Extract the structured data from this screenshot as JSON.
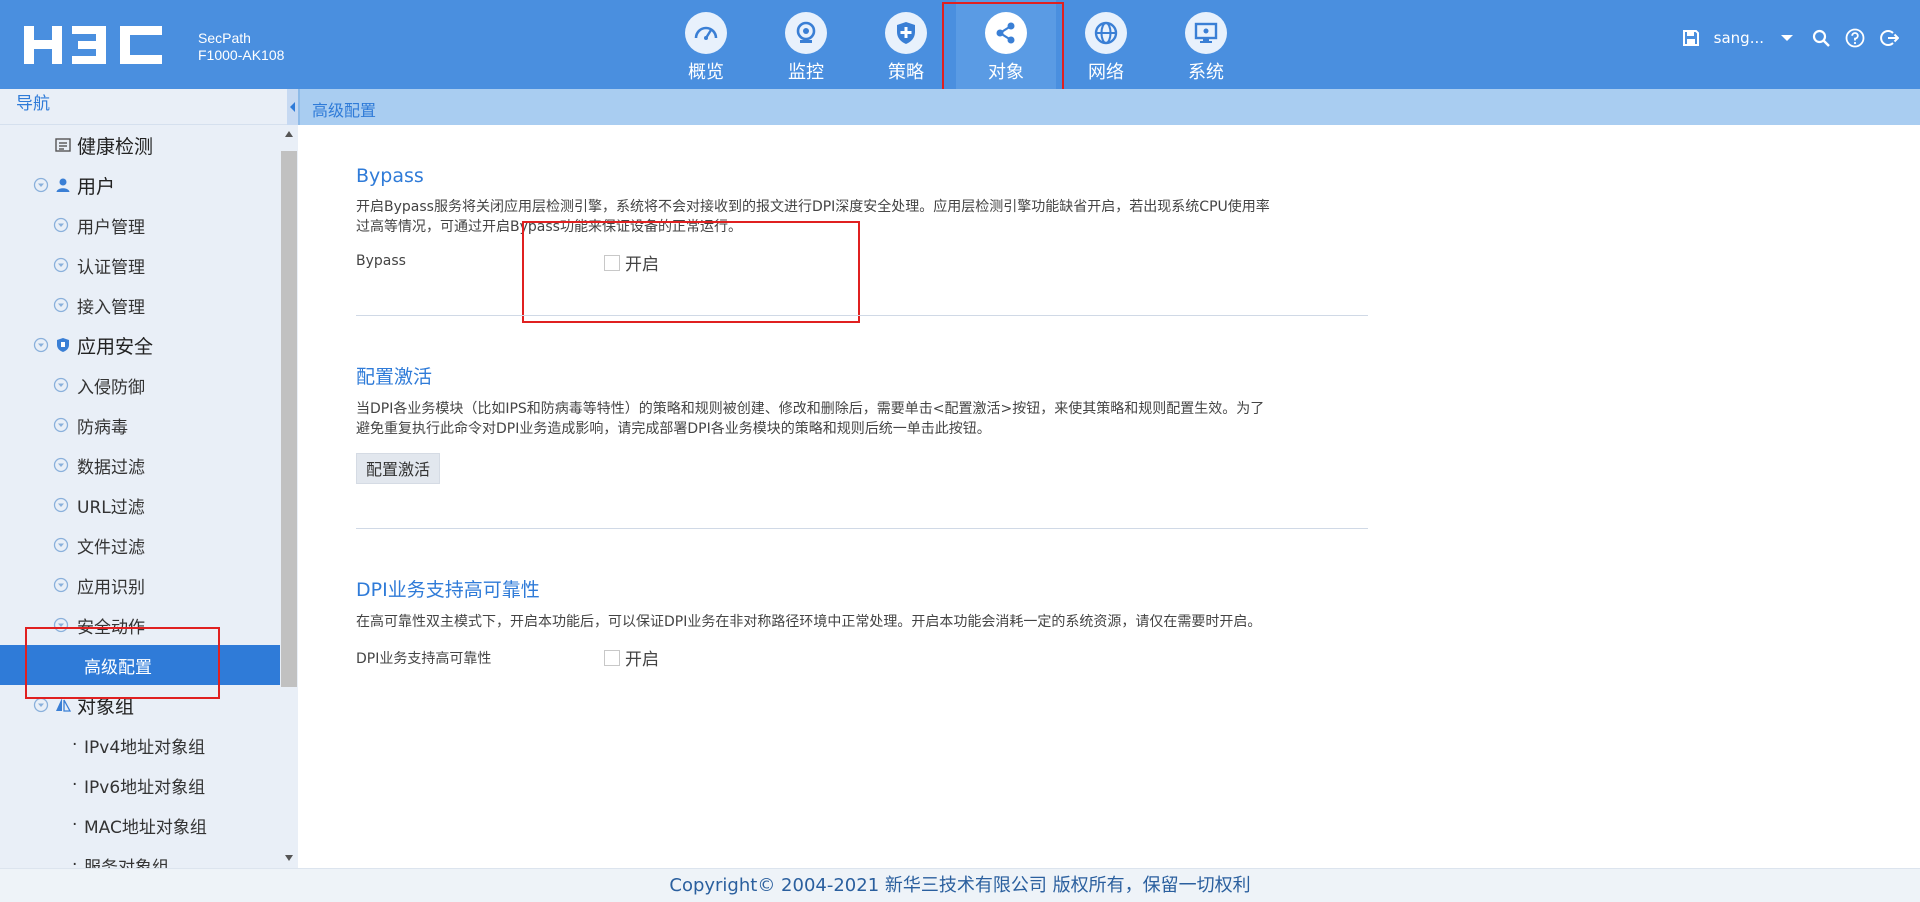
{
  "header": {
    "brand": "H3C",
    "product_line1": "SecPath",
    "product_line2": "F1000-AK108",
    "nav": [
      {
        "label": "概览",
        "icon": "dashboard-icon"
      },
      {
        "label": "监控",
        "icon": "camera-icon"
      },
      {
        "label": "策略",
        "icon": "shield-plus-icon"
      },
      {
        "label": "对象",
        "icon": "share-nodes-icon",
        "active": true
      },
      {
        "label": "网络",
        "icon": "globe-icon"
      },
      {
        "label": "系统",
        "icon": "monitor-icon"
      }
    ],
    "username": "sang...",
    "icons": [
      "save-icon",
      "chevron-down-icon",
      "search-icon",
      "help-icon",
      "logout-icon"
    ]
  },
  "sidebar": {
    "title": "导航",
    "items": [
      {
        "label": "健康检测",
        "level": 1,
        "icon": "health-check-icon"
      },
      {
        "label": "用户",
        "level": 1,
        "icon": "user-icon",
        "expandable": true
      },
      {
        "label": "用户管理",
        "level": 2
      },
      {
        "label": "认证管理",
        "level": 2
      },
      {
        "label": "接入管理",
        "level": 2
      },
      {
        "label": "应用安全",
        "level": 1,
        "icon": "shield-icon",
        "expandable": true
      },
      {
        "label": "入侵防御",
        "level": 2
      },
      {
        "label": "防病毒",
        "level": 2
      },
      {
        "label": "数据过滤",
        "level": 2
      },
      {
        "label": "URL过滤",
        "level": 2
      },
      {
        "label": "文件过滤",
        "level": 2
      },
      {
        "label": "应用识别",
        "level": 2
      },
      {
        "label": "安全动作",
        "level": 2
      },
      {
        "label": "高级配置",
        "level": 3,
        "selected": true
      },
      {
        "label": "对象组",
        "level": 1,
        "icon": "object-group-icon",
        "expandable": true
      },
      {
        "label": "IPv4地址对象组",
        "level": 3
      },
      {
        "label": "IPv6地址对象组",
        "level": 3
      },
      {
        "label": "MAC地址对象组",
        "level": 3
      },
      {
        "label": "服务对象组",
        "level": 3
      }
    ]
  },
  "breadcrumb": "高级配置",
  "sections": {
    "bypass": {
      "title": "Bypass",
      "desc": "开启Bypass服务将关闭应用层检测引擎，系统将不会对接收到的报文进行DPI深度安全处理。应用层检测引擎功能缺省开启，若出现系统CPU使用率过高等情况，可通过开启Bypass功能来保证设备的正常运行。",
      "field_label": "Bypass",
      "checkbox_label": "开启"
    },
    "activate": {
      "title": "配置激活",
      "desc": "当DPI各业务模块（比如IPS和防病毒等特性）的策略和规则被创建、修改和删除后，需要单击<配置激活>按钮，来使其策略和规则配置生效。为了避免重复执行此命令对DPI业务造成影响，请完成部署DPI各业务模块的策略和规则后统一单击此按钮。",
      "button_label": "配置激活"
    },
    "ha": {
      "title": "DPI业务支持高可靠性",
      "desc": "在高可靠性双主模式下，开启本功能后，可以保证DPI业务在非对称路径环境中正常处理。开启本功能会消耗一定的系统资源，请仅在需要时开启。",
      "field_label": "DPI业务支持高可靠性",
      "checkbox_label": "开启"
    }
  },
  "footer": "Copyright© 2004-2021 新华三技术有限公司 版权所有，保留一切权利",
  "colors": {
    "header_bg": "#4a8fdf",
    "accent": "#2f7bd8",
    "highlight_box": "#e02020",
    "sidebar_bg": "#e9eff7"
  }
}
